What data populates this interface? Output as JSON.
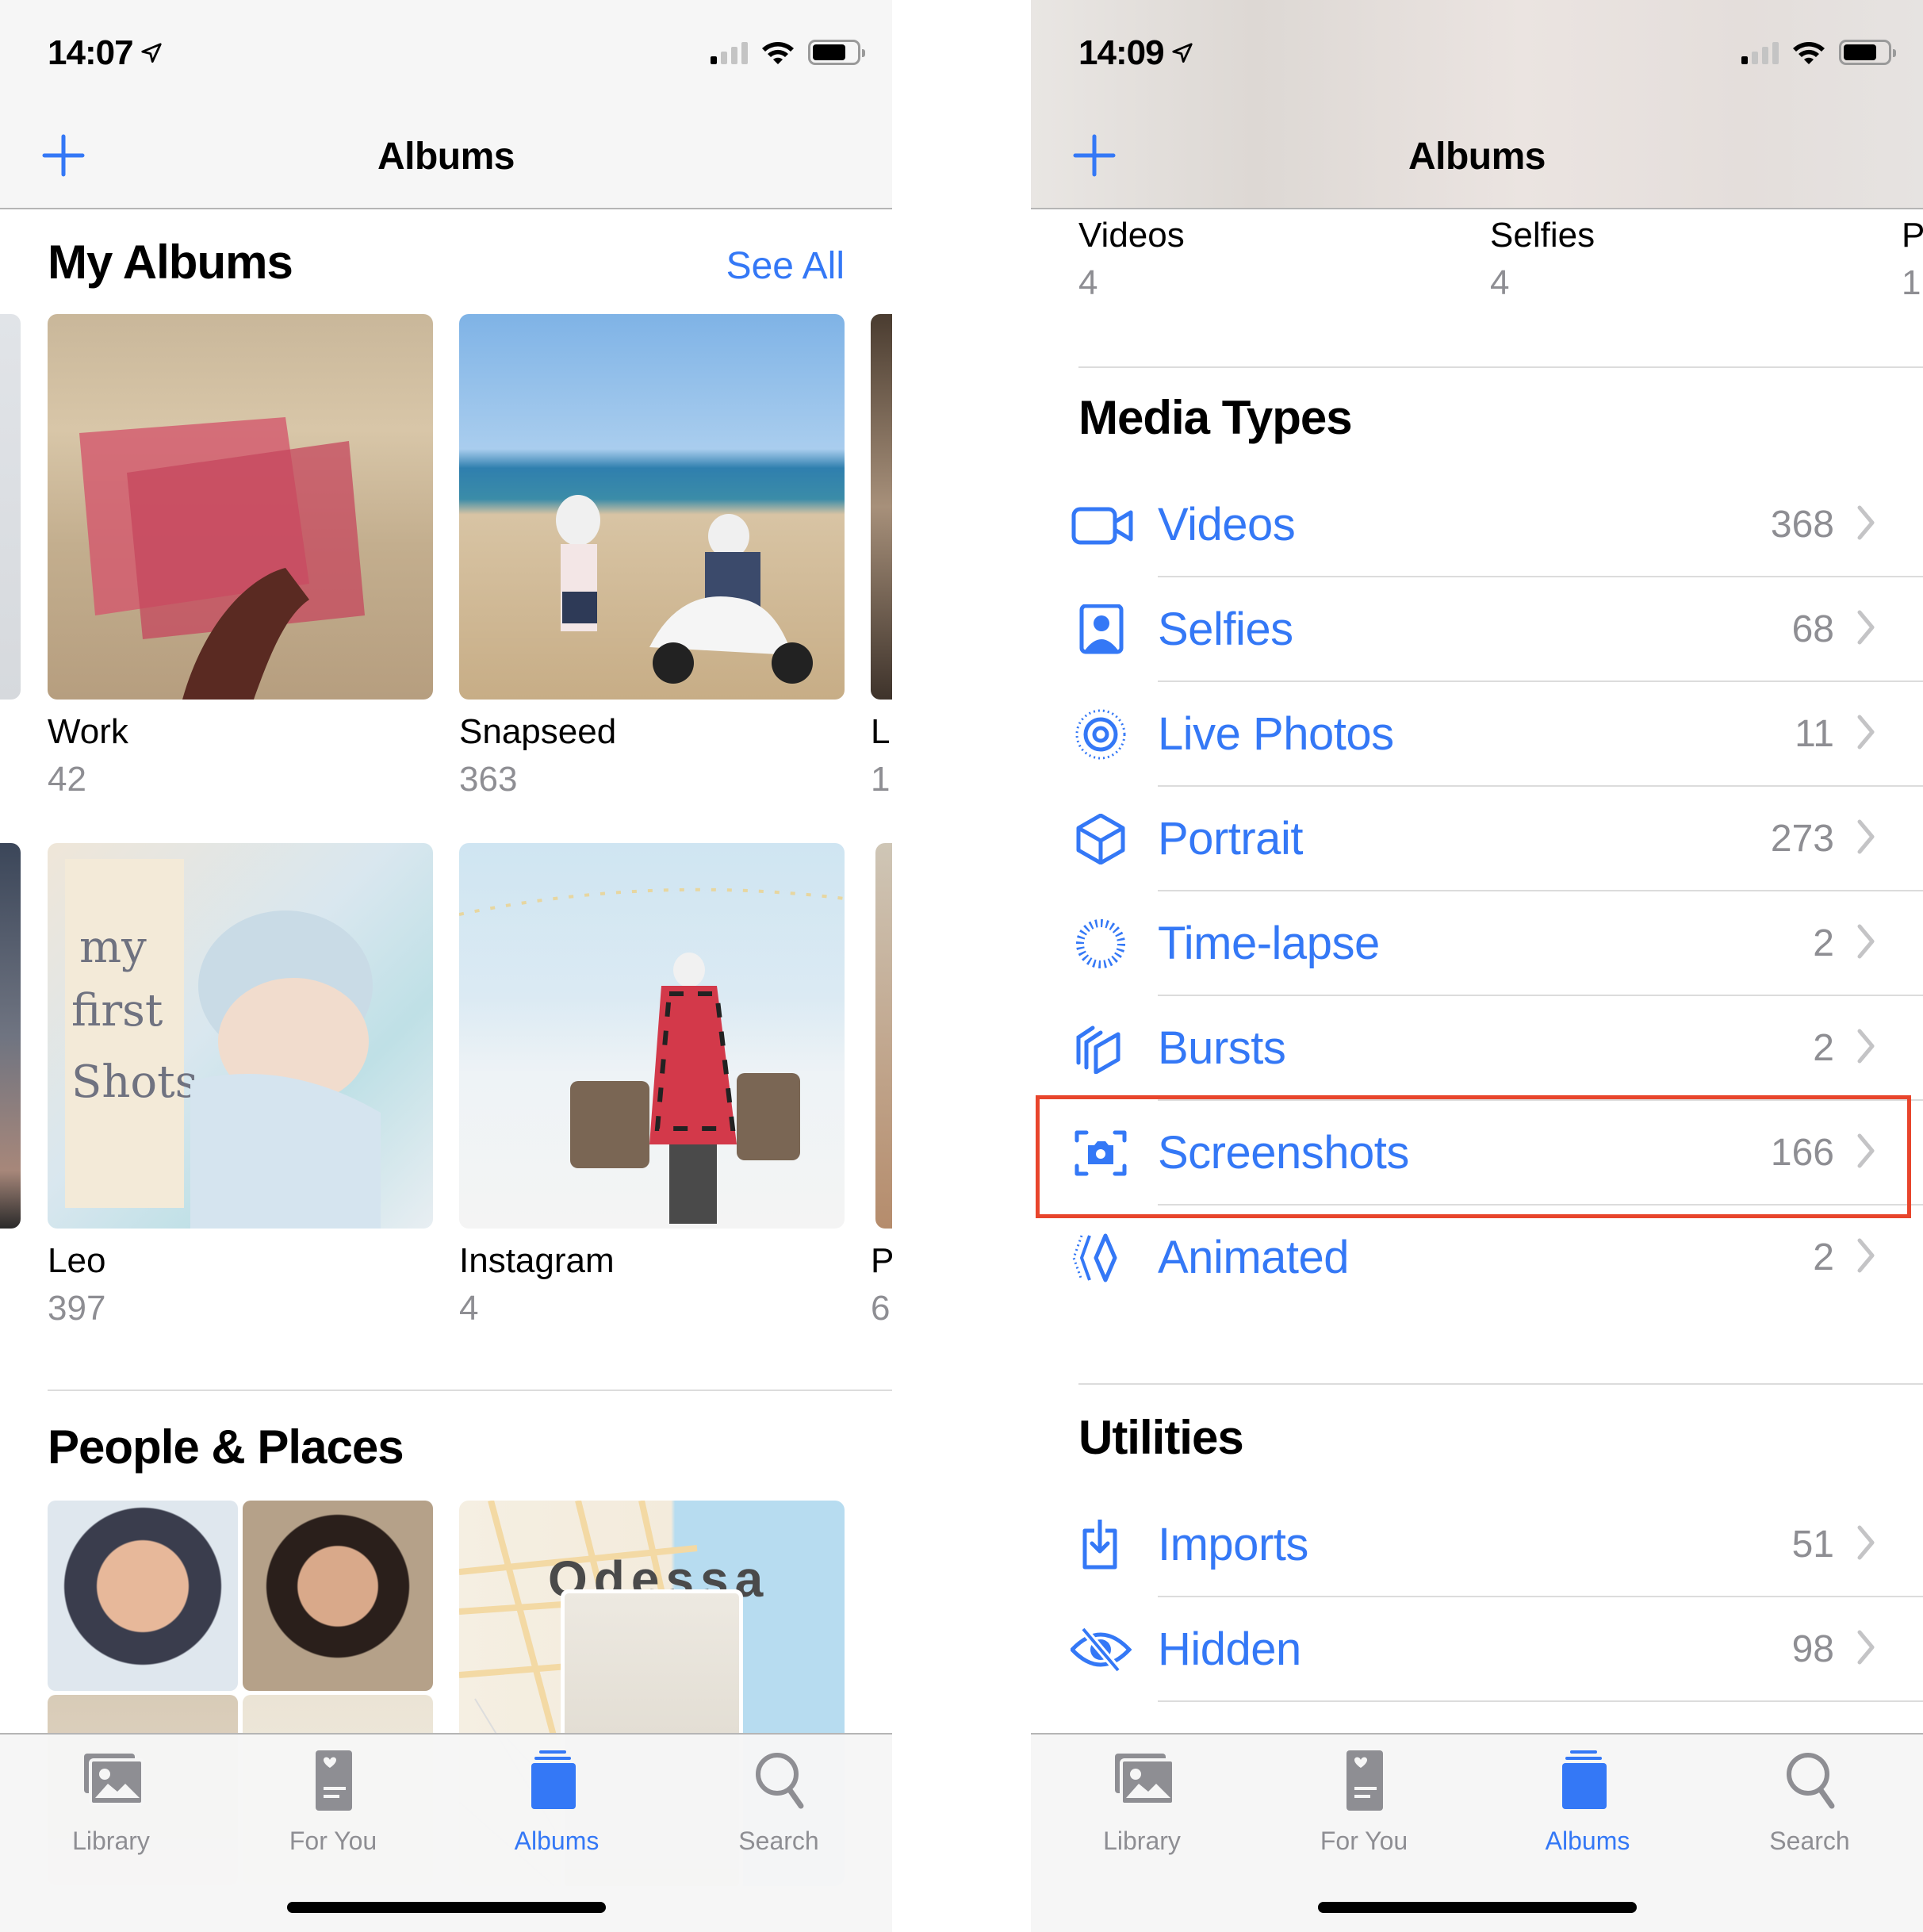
{
  "colors": {
    "accent": "#3478f6",
    "secondary_text": "#8e8e93",
    "highlight": "#e8452c"
  },
  "left": {
    "status": {
      "time": "14:07",
      "location_icon": "location-arrow-icon",
      "signal_bars_on": 1,
      "wifi_icon": "wifi-icon",
      "battery_icon": "battery-icon"
    },
    "nav": {
      "title": "Albums",
      "add_icon": "plus-icon"
    },
    "my_albums": {
      "title": "My Albums",
      "see_all": "See All",
      "albums": [
        {
          "name": "Work",
          "count": "42"
        },
        {
          "name": "Snapseed",
          "count": "363"
        },
        {
          "name": "L",
          "count": "1"
        },
        {
          "name": "Leo",
          "count": "397"
        },
        {
          "name": "Instagram",
          "count": "4"
        },
        {
          "name": "P",
          "count": "6"
        }
      ]
    },
    "people_places": {
      "title": "People & Places",
      "map_label": "Odessa"
    },
    "tabs": [
      {
        "label": "Library",
        "icon": "library-icon",
        "active": false
      },
      {
        "label": "For You",
        "icon": "for-you-icon",
        "active": false
      },
      {
        "label": "Albums",
        "icon": "albums-icon",
        "active": true
      },
      {
        "label": "Search",
        "icon": "search-icon",
        "active": false
      }
    ]
  },
  "right": {
    "status": {
      "time": "14:09",
      "location_icon": "location-arrow-icon",
      "signal_bars_on": 1,
      "wifi_icon": "wifi-icon",
      "battery_icon": "battery-icon"
    },
    "nav": {
      "title": "Albums",
      "add_icon": "plus-icon"
    },
    "top_grid": [
      {
        "name": "Videos",
        "count": "4"
      },
      {
        "name": "Selfies",
        "count": "4"
      },
      {
        "name": "P",
        "count": "1"
      }
    ],
    "media_types": {
      "title": "Media Types",
      "items": [
        {
          "label": "Videos",
          "count": "368",
          "icon": "video-camera-icon"
        },
        {
          "label": "Selfies",
          "count": "68",
          "icon": "selfie-icon"
        },
        {
          "label": "Live Photos",
          "count": "11",
          "icon": "live-photo-icon"
        },
        {
          "label": "Portrait",
          "count": "273",
          "icon": "portrait-cube-icon"
        },
        {
          "label": "Time-lapse",
          "count": "2",
          "icon": "timelapse-icon"
        },
        {
          "label": "Bursts",
          "count": "2",
          "icon": "bursts-icon"
        },
        {
          "label": "Screenshots",
          "count": "166",
          "icon": "screenshot-icon",
          "highlighted": true
        },
        {
          "label": "Animated",
          "count": "2",
          "icon": "animated-icon"
        }
      ]
    },
    "utilities": {
      "title": "Utilities",
      "items": [
        {
          "label": "Imports",
          "count": "51",
          "icon": "import-icon"
        },
        {
          "label": "Hidden",
          "count": "98",
          "icon": "hidden-eye-icon"
        }
      ]
    },
    "tabs": [
      {
        "label": "Library",
        "icon": "library-icon",
        "active": false
      },
      {
        "label": "For You",
        "icon": "for-you-icon",
        "active": false
      },
      {
        "label": "Albums",
        "icon": "albums-icon",
        "active": true
      },
      {
        "label": "Search",
        "icon": "search-icon",
        "active": false
      }
    ]
  }
}
